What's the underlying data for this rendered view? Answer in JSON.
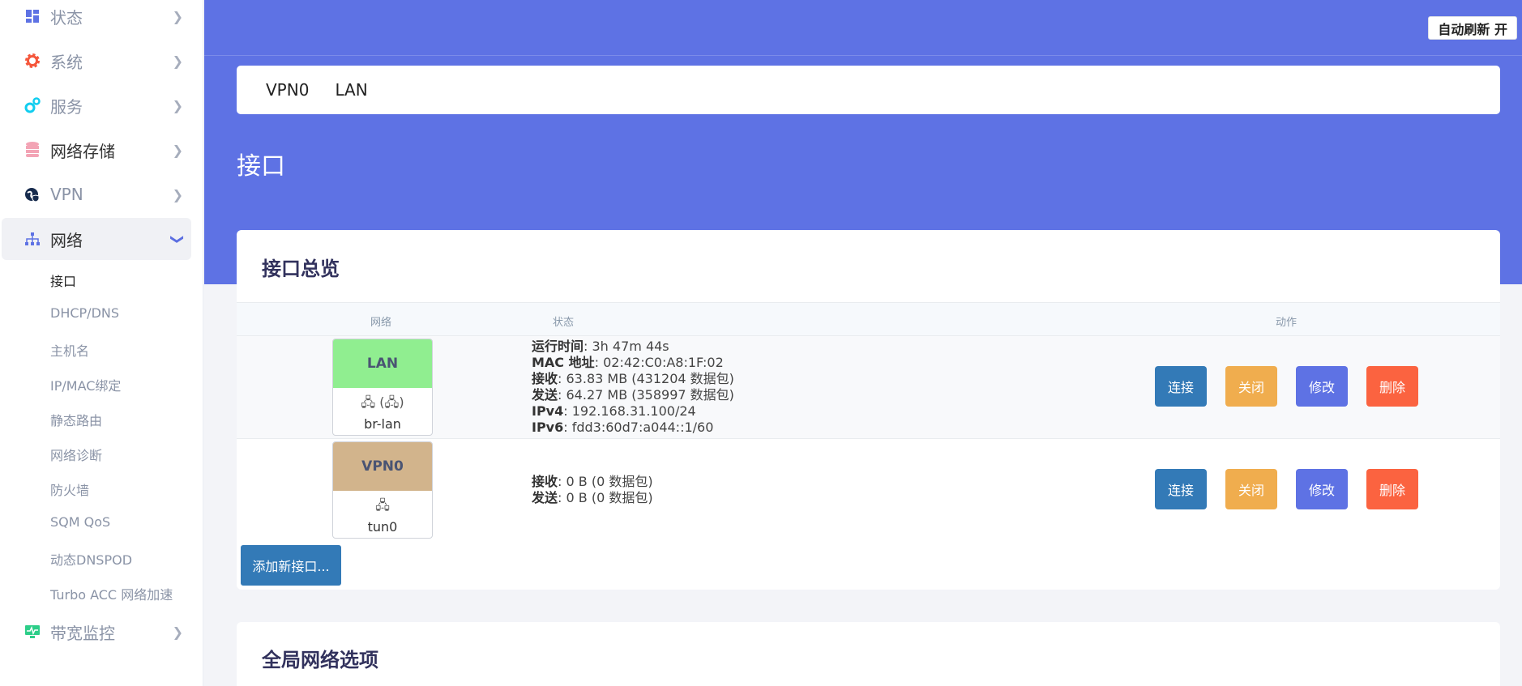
{
  "sidebar": {
    "menu": [
      {
        "label": "状态",
        "icon": "dashboard-icon"
      },
      {
        "label": "系统",
        "icon": "gear-icon"
      },
      {
        "label": "服务",
        "icon": "cogs-icon"
      },
      {
        "label": "网络存储",
        "icon": "database-icon"
      },
      {
        "label": "VPN",
        "icon": "globe-shield-icon"
      },
      {
        "label": "网络",
        "icon": "sitemap-icon"
      },
      {
        "label": "带宽监控",
        "icon": "monitor-icon"
      }
    ],
    "network_sub": [
      {
        "label": "接口"
      },
      {
        "label": "DHCP/DNS"
      },
      {
        "label": "主机名"
      },
      {
        "label": "IP/MAC绑定"
      },
      {
        "label": "静态路由"
      },
      {
        "label": "网络诊断"
      },
      {
        "label": "防火墙"
      },
      {
        "label": "SQM QoS"
      },
      {
        "label": "动态DNSPOD"
      },
      {
        "label": "Turbo ACC 网络加速"
      }
    ]
  },
  "header": {
    "refresh_label": "自动刷新 开",
    "tabs": [
      "VPN0",
      "LAN"
    ],
    "page_title": "接口"
  },
  "overview": {
    "title": "接口总览",
    "columns": {
      "network": "网络",
      "status": "状态",
      "action": "动作"
    },
    "interfaces": [
      {
        "name": "LAN",
        "color": "#90ee90",
        "icons": "🖧 (🖧)",
        "device": "br-lan",
        "status": [
          {
            "key": "运行时间",
            "value": "3h 47m 44s"
          },
          {
            "key": "MAC 地址",
            "value": "02:42:C0:A8:1F:02"
          },
          {
            "key": "接收",
            "value": "63.83 MB (431204 数据包)"
          },
          {
            "key": "发送",
            "value": "64.27 MB (358997 数据包)"
          },
          {
            "key": "IPv4",
            "value": "192.168.31.100/24"
          },
          {
            "key": "IPv6",
            "value": "fdd3:60d7:a044::1/60"
          }
        ]
      },
      {
        "name": "VPN0",
        "color": "#d2b48c",
        "icons": "🖧",
        "device": "tun0",
        "status": [
          {
            "key": "接收",
            "value": "0 B (0 数据包)"
          },
          {
            "key": "发送",
            "value": "0 B (0 数据包)"
          }
        ]
      }
    ],
    "actions": {
      "connect": "连接",
      "stop": "关闭",
      "edit": "修改",
      "delete": "删除"
    },
    "add_label": "添加新接口..."
  },
  "global": {
    "title": "全局网络选项"
  },
  "colors": {
    "accent": "#5e72e4",
    "connect": "#337ab7",
    "stop": "#f0ad4e",
    "delete": "#fb6340"
  }
}
